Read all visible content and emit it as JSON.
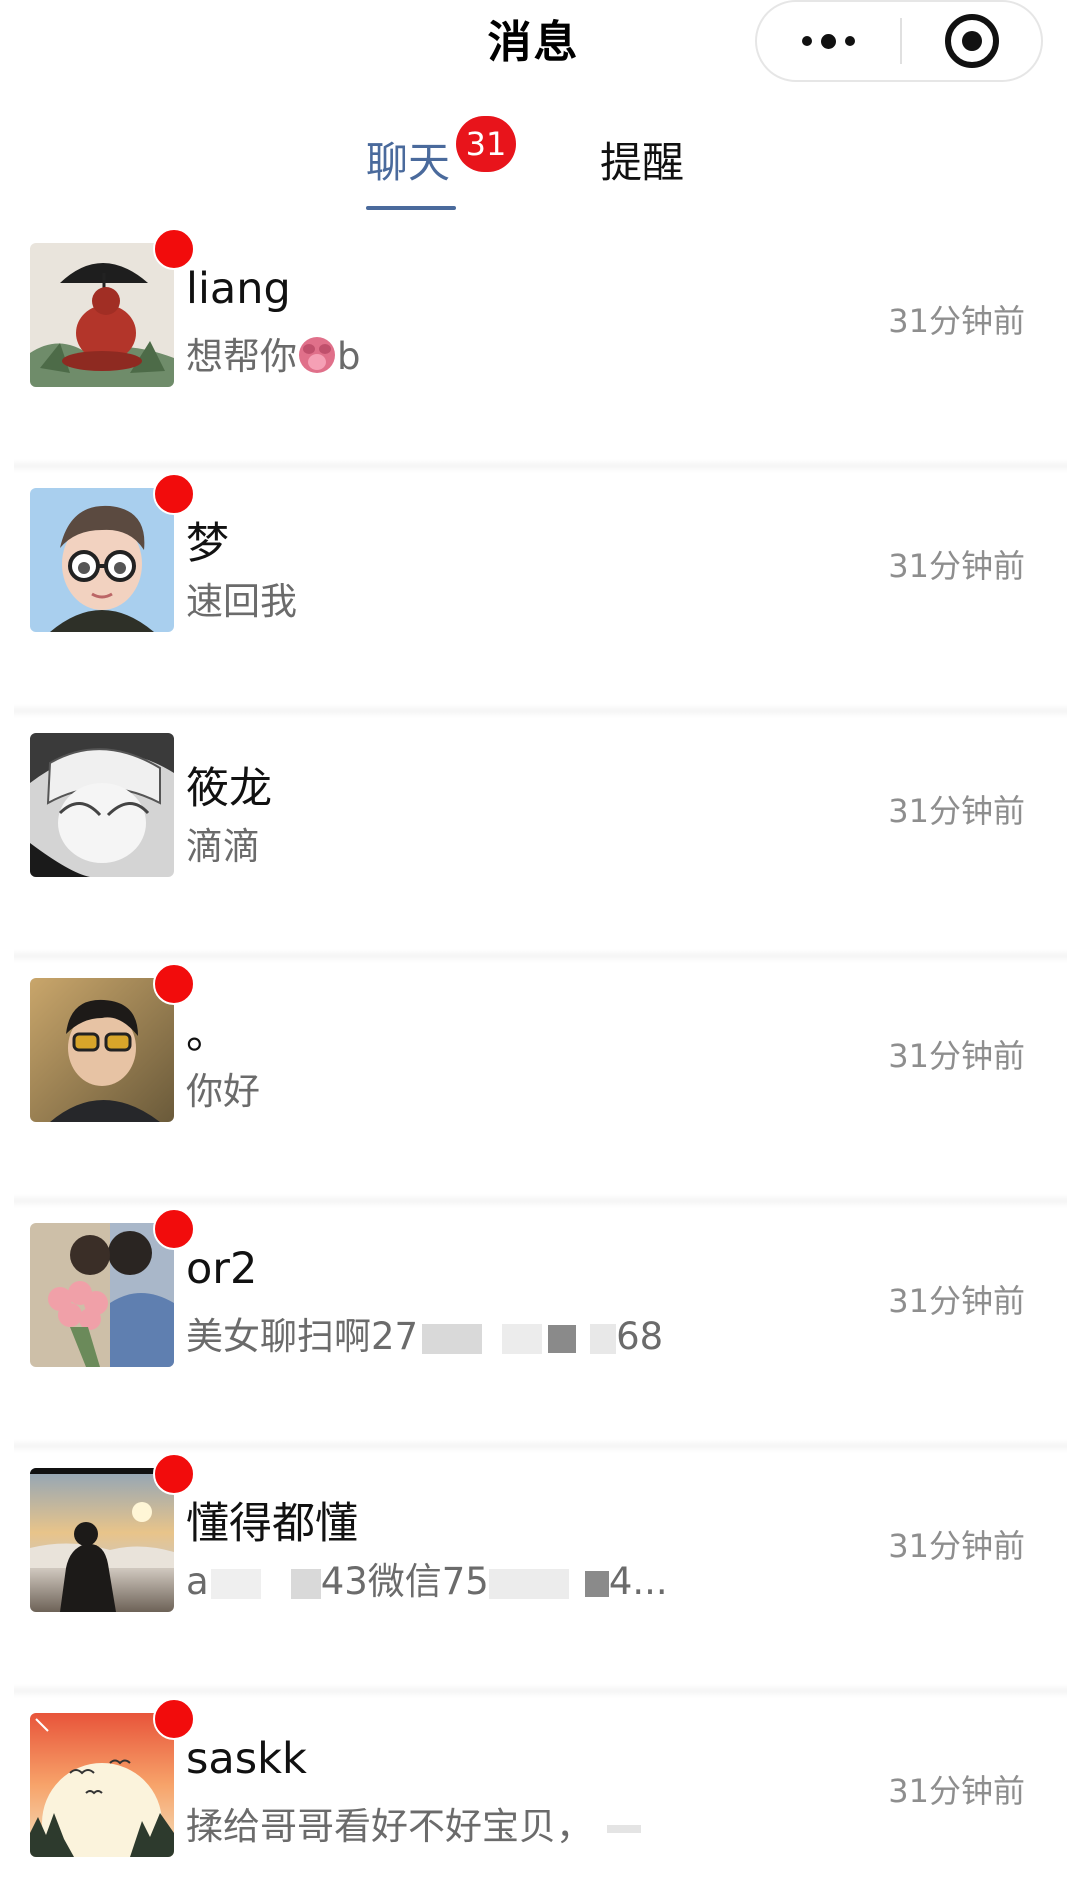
{
  "header": {
    "title": "消息",
    "more_icon": "more-dots-icon",
    "close_icon": "target-close-icon"
  },
  "tabs": [
    {
      "label": "聊天",
      "badge": "31",
      "active": true
    },
    {
      "label": "提醒",
      "active": false
    }
  ],
  "colors": {
    "accent": "#4a6a9c",
    "badge_red": "#e8141b",
    "unread_red": "#f20c0c",
    "time_gray": "#8e8e8e",
    "preview_gray": "#6b6b6b"
  },
  "chats": [
    {
      "name": "liang",
      "preview_text": "想帮你",
      "preview_emoji": "tongue-emoji-icon",
      "preview_suffix": "b",
      "time": "31分钟前",
      "unread": true,
      "avatar": "umbrella-figure-avatar"
    },
    {
      "name": "梦",
      "preview": "速回我",
      "time": "31分钟前",
      "unread": true,
      "avatar": "cartoon-glasses-boy-avatar"
    },
    {
      "name": "筱龙",
      "preview": "滴滴",
      "time": "31分钟前",
      "unread": false,
      "avatar": "anime-boy-avatar"
    },
    {
      "name": "。",
      "preview": "你好",
      "time": "31分钟前",
      "unread": true,
      "avatar": "boy-sunglasses-avatar"
    },
    {
      "name": "or2",
      "preview_a": "美女聊扫啊27",
      "preview_b": "68",
      "time": "31分钟前",
      "unread": true,
      "avatar": "roses-couple-avatar"
    },
    {
      "name": "懂得都懂",
      "preview_a": "a",
      "preview_b": "43微信75",
      "preview_c": "4...",
      "time": "31分钟前",
      "unread": true,
      "avatar": "sunset-silhouette-avatar"
    },
    {
      "name": "saskk",
      "preview": "揉给哥哥看好不好宝贝，",
      "time": "31分钟前",
      "unread": true,
      "avatar": "sunrise-birds-avatar"
    }
  ]
}
